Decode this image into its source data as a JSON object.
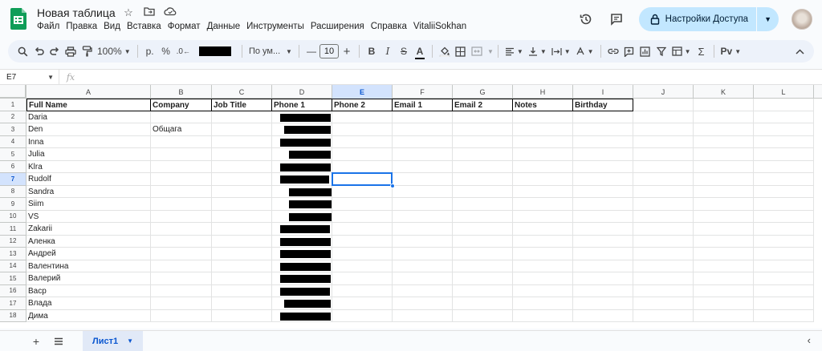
{
  "document": {
    "title": "Новая таблица",
    "menu": [
      "Файл",
      "Правка",
      "Вид",
      "Вставка",
      "Формат",
      "Данные",
      "Инструменты",
      "Расширения",
      "Справка",
      "VitaliiSokhan"
    ],
    "share_label": "Настройки Доступа"
  },
  "toolbar": {
    "zoom": "100%",
    "currency": "р.",
    "percent": "%",
    "decimal": ".0",
    "font": "По ум...",
    "font_size": "10"
  },
  "formula_bar": {
    "cell_ref": "E7",
    "fx": "fx",
    "value": ""
  },
  "grid": {
    "columns": [
      "A",
      "B",
      "C",
      "D",
      "E",
      "F",
      "G",
      "H",
      "I",
      "J",
      "K",
      "L"
    ],
    "selected_column": "E",
    "selected_row": 7,
    "header": [
      "Full Name",
      "Company",
      "Job Title",
      "Phone 1",
      "Phone 2",
      "Email 1",
      "Email 2",
      "Notes",
      "Birthday"
    ],
    "rows": [
      {
        "n": "1"
      },
      {
        "n": "2",
        "name": "Daria",
        "company": ""
      },
      {
        "n": "3",
        "name": "Den",
        "company": "Общага"
      },
      {
        "n": "4",
        "name": "Inna",
        "company": ""
      },
      {
        "n": "5",
        "name": "Julia",
        "company": ""
      },
      {
        "n": "6",
        "name": "Klra",
        "company": ""
      },
      {
        "n": "7",
        "name": "Rudolf",
        "company": ""
      },
      {
        "n": "8",
        "name": "Sandra",
        "company": ""
      },
      {
        "n": "9",
        "name": "Siim",
        "company": ""
      },
      {
        "n": "10",
        "name": "VS",
        "company": ""
      },
      {
        "n": "11",
        "name": "Zakarii",
        "company": ""
      },
      {
        "n": "12",
        "name": "Аленка",
        "company": ""
      },
      {
        "n": "13",
        "name": "Андрей",
        "company": ""
      },
      {
        "n": "14",
        "name": "Валентина",
        "company": ""
      },
      {
        "n": "15",
        "name": "Валерий",
        "company": ""
      },
      {
        "n": "16",
        "name": "Васр",
        "company": ""
      },
      {
        "n": "17",
        "name": "Влада",
        "company": ""
      },
      {
        "n": "18",
        "name": "Дима",
        "company": ""
      }
    ]
  },
  "sheets": {
    "active": "Лист1"
  }
}
